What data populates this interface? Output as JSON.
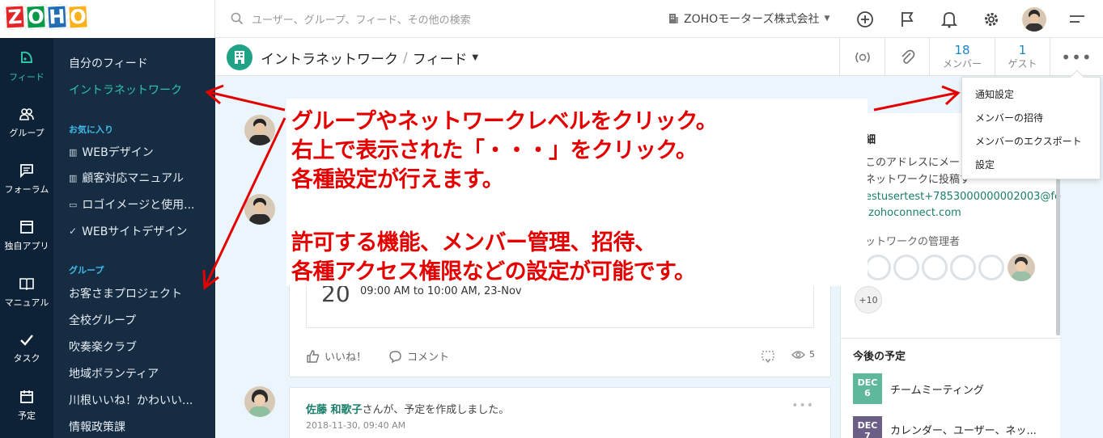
{
  "logo": {
    "letters": [
      "Z",
      "O",
      "H",
      "O"
    ],
    "colors": [
      "#e42527",
      "#089949",
      "#226db4",
      "#f9b21d"
    ]
  },
  "search": {
    "placeholder": "ユーザー、グループ、フィード、その他の検索"
  },
  "org": {
    "name": "ZOHOモーターズ株式会社"
  },
  "top_icons": [
    "plus-circle-icon",
    "flag-icon",
    "bell-icon",
    "gear-icon",
    "avatar",
    "menu-icon"
  ],
  "rail": [
    {
      "label": "フィード",
      "icon": "feed-icon",
      "active": true
    },
    {
      "label": "グループ",
      "icon": "group-icon"
    },
    {
      "label": "フォーラム",
      "icon": "forum-icon"
    },
    {
      "label": "独自アプリ",
      "icon": "app-icon"
    },
    {
      "label": "マニュアル",
      "icon": "manual-icon"
    },
    {
      "label": "タスク",
      "icon": "check-icon"
    },
    {
      "label": "予定",
      "icon": "calendar-icon"
    }
  ],
  "nav": {
    "my_feed": "自分のフィード",
    "intranet": "イントラネットワーク",
    "favorites_title": "お気に入り",
    "favorites": [
      "WEBデザイン",
      "顧客対応マニュアル",
      "ロゴイメージと使用...",
      "WEBサイトデザイン"
    ],
    "groups_title": "グループ",
    "groups": [
      "お客さまプロジェクト",
      "全校グループ",
      "吹奏楽クラブ",
      "地域ボランティア",
      "川根いいね！かわいい...",
      "情報政策課"
    ]
  },
  "header": {
    "title": "イントラネットワーク",
    "separator": "/",
    "view": "フィード",
    "members_count": "18",
    "members_label": "メンバー",
    "guests_count": "1",
    "guests_label": "ゲスト"
  },
  "menu": [
    "通知設定",
    "メンバーの招待",
    "メンバーのエクスポート",
    "設定"
  ],
  "callout": {
    "lines": [
      "グループやネットワークレベルをクリック。",
      "右上で表示された「・・・」をクリック。",
      "各種設定が行えます。",
      "許可する機能、メンバー管理、招待、",
      "各種アクセス権限などの設定が可能です。"
    ]
  },
  "event_card": {
    "day": "20",
    "time": "09:00 AM to 10:00 AM, 23-Nov",
    "like": "いいね！",
    "comment": "コメント",
    "views": "5"
  },
  "post": {
    "author": "佐藤 和歌子",
    "action": "さんが、予定を作成しました。",
    "date": "2018-11-30, 09:40 AM"
  },
  "side": {
    "heading_partial": "細",
    "desc1": "このアドレスにメー",
    "desc2": "ネットワークに投稿す",
    "email1": "estusertest+7853000000002003@fe",
    "email2": ".zohoconnect.com",
    "admins_label": "ットワークの管理者",
    "more": "+10",
    "upcoming_title": "今後の予定",
    "events": [
      {
        "month": "DEC",
        "day": "6",
        "title": "チームミーティング",
        "color": "#5fb89d"
      },
      {
        "month": "DEC",
        "day": "7",
        "title": "カレンダー、ユーザー、ネッ...",
        "color": "#6b5f88"
      }
    ]
  },
  "colors": {
    "accent": "#2ec4a7",
    "rail": "#0d2236",
    "nav": "#152c43",
    "link": "#1a86c8",
    "annotation": "#e50000"
  }
}
